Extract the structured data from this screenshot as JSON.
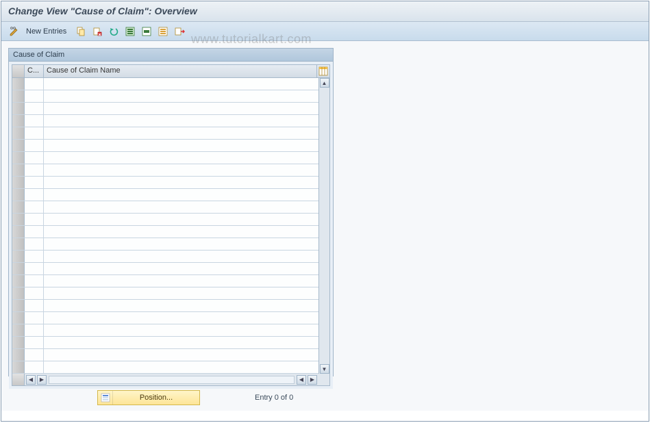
{
  "header": {
    "title": "Change View \"Cause of Claim\": Overview"
  },
  "toolbar": {
    "new_entries_label": "New Entries"
  },
  "panel": {
    "title": "Cause of Claim",
    "columns": {
      "code": "C...",
      "name": "Cause of Claim Name"
    }
  },
  "footer": {
    "position_label": "Position...",
    "entry_text": "Entry 0 of 0"
  },
  "watermark": "www.tutorialkart.com",
  "row_count": 24
}
